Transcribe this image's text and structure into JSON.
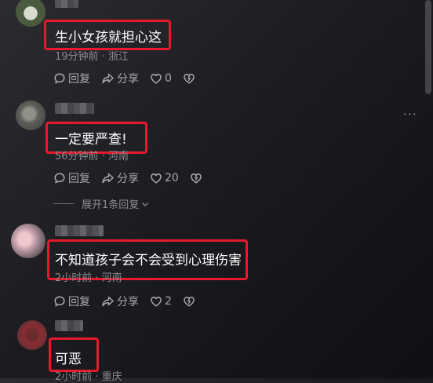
{
  "comments": [
    {
      "text": "生小女孩就担心这",
      "meta": "19分钟前 · 浙江",
      "reply_label": "回复",
      "share_label": "分享",
      "like_count": "0"
    },
    {
      "text": "一定要严查!",
      "meta": "56分钟前 · 河南",
      "reply_label": "回复",
      "share_label": "分享",
      "like_count": "20",
      "expand_label": "展开1条回复"
    },
    {
      "text": "不知道孩子会不会受到心理伤害",
      "meta": "2小时前 · 河南",
      "reply_label": "回复",
      "share_label": "分享",
      "like_count": "2"
    },
    {
      "text": "可恶",
      "meta": "2小时前 · 重庆"
    }
  ],
  "more_label": "···",
  "colors": {
    "highlight": "#e8192c",
    "background": "#1d1e22",
    "meta_text": "#8a8b90"
  },
  "icons": [
    "comment-icon",
    "share-icon",
    "heart-icon",
    "dislike-heart-icon",
    "chevron-down-icon"
  ]
}
